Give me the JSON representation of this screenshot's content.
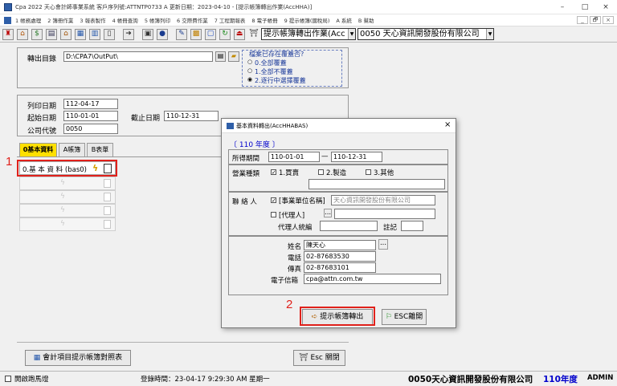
{
  "window": {
    "title": "Cpa 2022  天心會計師事業系統  客戶序列號:ATTNTP0733 A   更新日期：2023-04-10 - [提示帳簿轉出作業(AccHHA)]",
    "minimize": "–",
    "maximize": "□",
    "close": "×"
  },
  "menu": {
    "items": [
      "1 帳務處理",
      "2 簿冊作業",
      "3 報表製作",
      "4 帳冊查詢",
      "5 帳簿列印",
      "6 交際費作業",
      "7 工程期報表",
      "8 電子帳冊",
      "9 提示帳簿(國稅局)",
      "A 系統",
      "B 幫助"
    ],
    "mdi_min": "_",
    "mdi_restore": "🗗",
    "mdi_close": "×"
  },
  "toolbar": {
    "program_combo": "提示帳簿轉出作業(Acc",
    "company_combo": "0050  天心資訊開發股份有限公司"
  },
  "output": {
    "label": "轉出目錄",
    "path": "D:\\CPA7\\OutPut\\",
    "overwrite_title": "檔案已存在覆蓋否?",
    "options": [
      "0.全部覆蓋",
      "1.全部不覆蓋",
      "2.逐行中選擇覆蓋"
    ],
    "selected": 2
  },
  "params": {
    "print_date_label": "列印日期",
    "print_date": "112-04-17",
    "start_date_label": "起始日期",
    "start_date": "110-01-01",
    "end_date_label": "截止日期",
    "end_date": "110-12-31",
    "company_code_label": "公司代號",
    "company_code": "0050"
  },
  "tabs": [
    "0基本資料",
    "A帳簿",
    "B表單"
  ],
  "basic_item": "0.基 本 資 料 (bas0)",
  "dialog": {
    "title": "基本資料轉出(AccHHABAS)",
    "close": "×",
    "year": "〔 110 年度 〕",
    "period_label": "所得期間",
    "period_from": "110-01-01",
    "period_sep": "—",
    "period_to": "110-12-31",
    "business_label": "營業種類",
    "business_options": [
      "1.買賣",
      "2.製造",
      "3.其他"
    ],
    "business_checked": [
      true,
      false,
      false
    ],
    "contact_label": "聯 絡 人",
    "entity_name_label": "[事業單位名稱]",
    "entity_name": "天心資訊開發股份有限公司",
    "agent_label": "[代理人]",
    "agent_browse": "...",
    "agent_id_label": "代理人統編",
    "note_label": "註記",
    "name_label": "姓名",
    "name": "陳天心",
    "name_browse": "...",
    "phone_label": "電話",
    "phone": "02-87683530",
    "fax_label": "傳真",
    "fax": "02-87683101",
    "email_label": "電子信箱",
    "email": "cpa@attn.com.tw",
    "export_button": "提示帳簿轉出",
    "esc_button": "ESC離開"
  },
  "bottom": {
    "mapping_button": "會計項目提示帳簿對照表",
    "close_button": "Esc 關閉"
  },
  "status": {
    "marquee": "開啟跑馬燈",
    "login": "登錄時間：23-04-17 9:29:30 AM  星期一",
    "company": "0050天心資訊開發股份有限公司",
    "year": "110年度",
    "user": "ADMIN"
  },
  "annotations": [
    "1",
    "2"
  ],
  "colors": {
    "active_tab": "#ffe000",
    "highlight": "#e0211b",
    "year_blue": "#0000cc"
  }
}
